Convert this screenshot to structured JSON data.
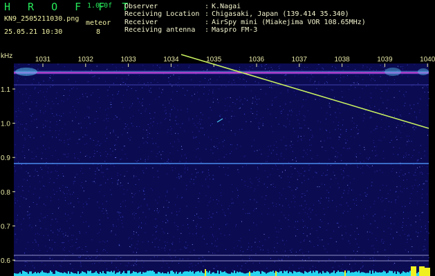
{
  "header": {
    "app_title": "H R O F F T",
    "version": "1.0.0f",
    "filename": "KN9_2505211030.png",
    "datetime": "25.05.21 10:30",
    "meteor_label": "meteor",
    "meteor_count": "8",
    "info": [
      {
        "key": "Observer",
        "sep": ":",
        "value": "K.Nagai"
      },
      {
        "key": "Receiving Location",
        "sep": ":",
        "value": "Chigasaki, Japan (139.414 35.340)"
      },
      {
        "key": "Receiver",
        "sep": ":",
        "value": "AirSpy mini (Miakejima VOR 108.65MHz)"
      },
      {
        "key": "Receiving antenna",
        "sep": ":",
        "value": "Maspro FM-3"
      }
    ]
  },
  "spectrogram": {
    "unit_label": "kHz",
    "time_ticks": [
      "1031",
      "1032",
      "1033",
      "1034",
      "1035",
      "1036",
      "1037",
      "1038",
      "1039",
      "1040"
    ],
    "freq_ticks": [
      "1.1",
      "1.0",
      "0.9",
      "0.8",
      "0.7",
      "0.6"
    ],
    "freq_tick_values": [
      1.1,
      1.0,
      0.9,
      0.8,
      0.7,
      0.6
    ],
    "colors": {
      "background": "#0b0b52",
      "noise": "#3a48c8",
      "carrier": "#d84ae0",
      "trace": "#c8f060",
      "baseline": "#26d6f0",
      "peak": "#f0f020",
      "lines": "#8080c0"
    }
  }
}
